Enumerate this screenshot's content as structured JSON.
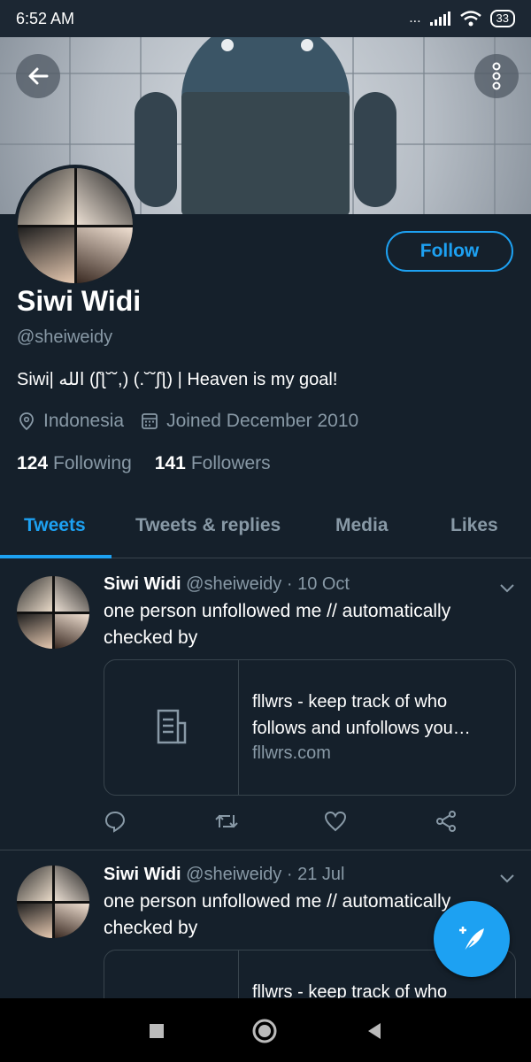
{
  "status": {
    "time": "6:52 AM",
    "dots": "...",
    "battery": "33"
  },
  "profile": {
    "name": "Siwi Widi",
    "handle": "@sheiweidy",
    "bio": "Siwi| الله (ʃƪ˘˘,) (.˘˘ʃƪ) | Heaven is my goal!",
    "location": "Indonesia",
    "joined": "Joined December 2010",
    "following_count": "124",
    "following_label": "Following",
    "followers_count": "141",
    "followers_label": "Followers",
    "follow_label": "Follow"
  },
  "tabs": [
    {
      "label": "Tweets"
    },
    {
      "label": "Tweets & replies"
    },
    {
      "label": "Media"
    },
    {
      "label": "Likes"
    }
  ],
  "tweets": [
    {
      "name": "Siwi Widi",
      "meta": "@sheiweidy · 10 Oct",
      "text": "one person unfollowed me // automatically checked by",
      "card_title": "fllwrs - keep track of who follows and unfollows you…",
      "card_domain": "fllwrs.com"
    },
    {
      "name": "Siwi Widi",
      "meta": "@sheiweidy · 21 Jul",
      "text": "one person unfollowed me // automatically checked by",
      "card_title": "fllwrs - keep track of who"
    }
  ],
  "colors": {
    "accent": "#1da1f2",
    "background": "#15202b",
    "muted": "#8899a6",
    "border": "#38444d"
  }
}
